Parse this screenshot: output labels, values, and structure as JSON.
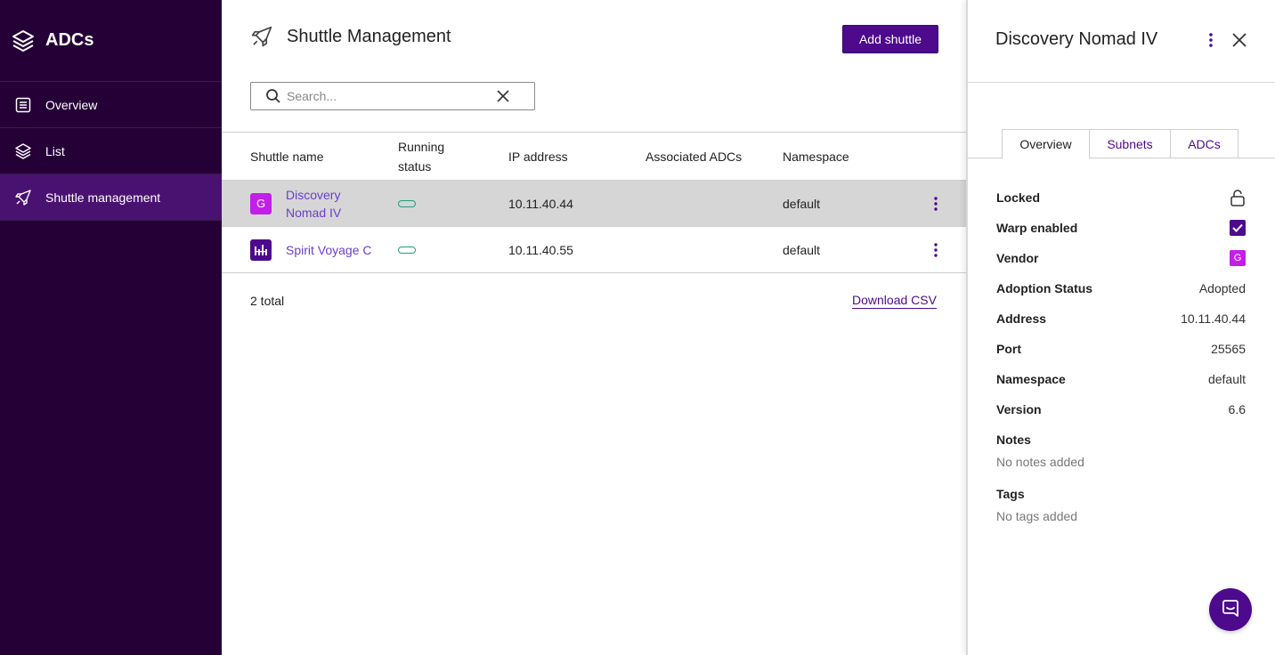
{
  "sidebar": {
    "brand_title": "ADCs",
    "items": [
      {
        "label": "Overview",
        "icon": "overview-icon"
      },
      {
        "label": "List",
        "icon": "layers-icon"
      },
      {
        "label": "Shuttle management",
        "icon": "rocket-icon",
        "active": true
      }
    ]
  },
  "main": {
    "title": "Shuttle Management",
    "add_button": "Add shuttle",
    "search": {
      "placeholder": "Search...",
      "value": ""
    },
    "table": {
      "headers": {
        "name": "Shuttle name",
        "status_line1": "Running",
        "status_line2": "status",
        "ip": "IP address",
        "adcs": "Associated ADCs",
        "namespace": "Namespace"
      },
      "rows": [
        {
          "badge": "G",
          "name": "Discovery Nomad IV",
          "ip": "10.11.40.44",
          "adcs": "",
          "namespace": "default",
          "selected": true
        },
        {
          "badge": "",
          "name": "Spirit Voyage C",
          "ip": "10.11.40.55",
          "adcs": "",
          "namespace": "default",
          "selected": false
        }
      ]
    },
    "total": "2 total",
    "download": "Download CSV"
  },
  "panel": {
    "title": "Discovery Nomad IV",
    "tabs": [
      "Overview",
      "Subnets",
      "ADCs"
    ],
    "props": {
      "locked": "Locked",
      "warp": "Warp enabled",
      "vendor": "Vendor",
      "vendor_badge": "G",
      "adoption_k": "Adoption Status",
      "adoption_v": "Adopted",
      "address_k": "Address",
      "address_v": "10.11.40.44",
      "port_k": "Port",
      "port_v": "25565",
      "namespace_k": "Namespace",
      "namespace_v": "default",
      "version_k": "Version",
      "version_v": "6.6"
    },
    "notes_k": "Notes",
    "notes_v": "No notes added",
    "tags_k": "Tags",
    "tags_v": "No tags added"
  },
  "colors": {
    "sidebar_bg": "#250037",
    "sidebar_active": "#4a1270",
    "primary": "#4d0a8c",
    "link": "#6a3fc9",
    "vendor_g": "#c21fe8",
    "status_green": "#1aa07a"
  }
}
